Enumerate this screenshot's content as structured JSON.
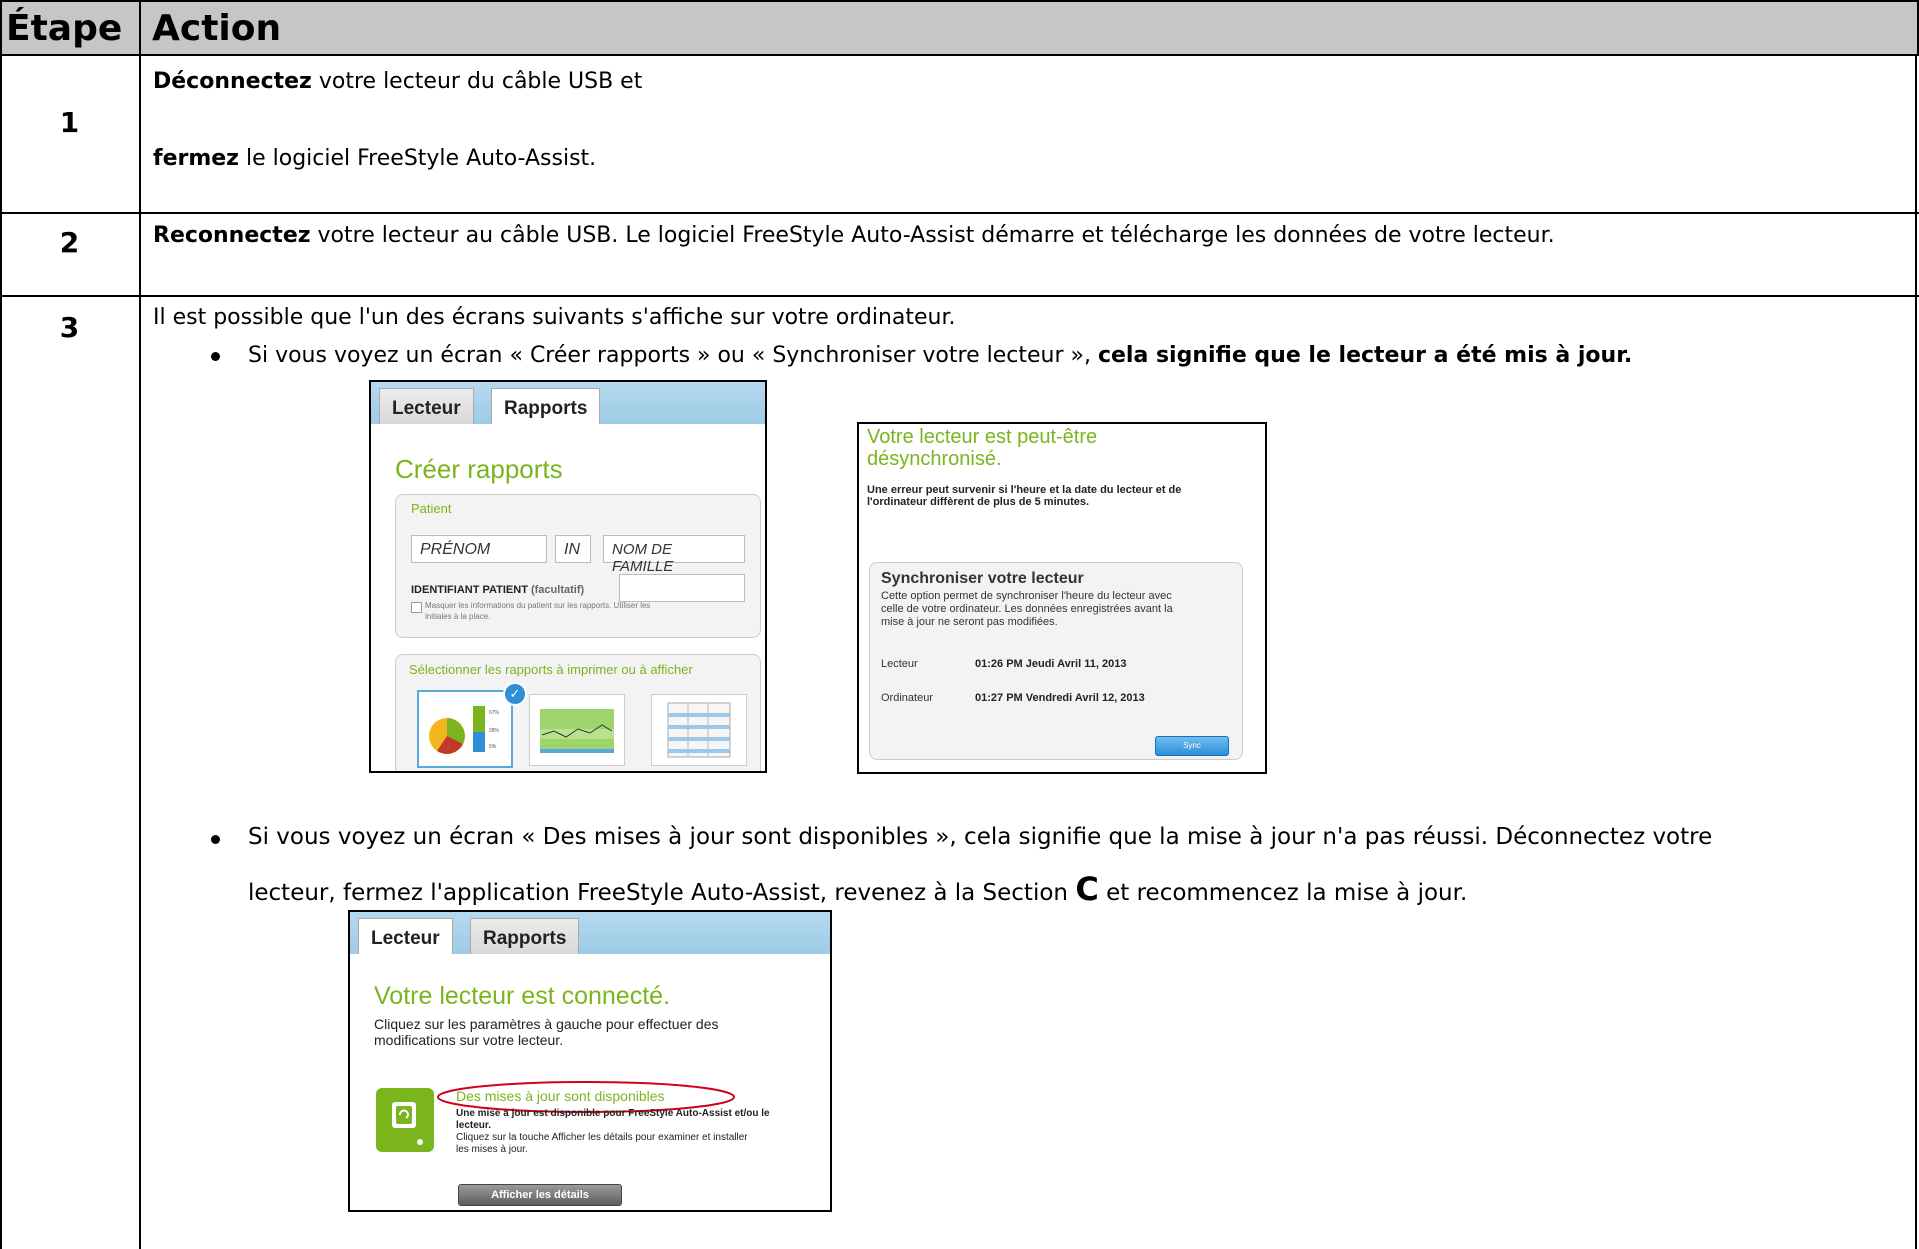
{
  "table": {
    "header": {
      "col1": "Étape",
      "col2": "Action"
    },
    "steps": [
      {
        "number": "1",
        "line1_bold": "Déconnectez",
        "line1_rest": " votre lecteur du câble USB et",
        "line2_bold": "fermez",
        "line2_rest": " le logiciel FreeStyle Auto-Assist."
      },
      {
        "number": "2",
        "line1_bold": "Reconnectez",
        "line1_rest": " votre lecteur au câble USB. Le logiciel FreeStyle Auto-Assist démarre et télécharge les données de votre lecteur."
      },
      {
        "number": "3",
        "intro": "Il est possible que l'un des écrans suivants s'affiche sur votre ordinateur.",
        "bullet1_plain": "Si vous voyez un écran « Créer rapports » ou « Synchroniser votre lecteur », ",
        "bullet1_bold": "cela signifie que le lecteur a été mis à jour.",
        "bullet2_line1": "Si vous voyez un écran « Des mises à jour sont disponibles », cela signifie que la mise à jour n'a pas réussi. Déconnectez votre",
        "bullet2_line2_a": "lecteur, fermez l'application FreeStyle Auto-Assist, revenez à la Section ",
        "bullet2_line2_c": "C",
        "bullet2_line2_b": " et recommencez la mise à jour."
      }
    ]
  },
  "shot_reports": {
    "tab_lecteur": "Lecteur",
    "tab_rapports": "Rapports",
    "title": "Créer rapports",
    "patient_label": "Patient",
    "first_name": "PRÉNOM",
    "initial": "IN",
    "last_name": "NOM DE FAMILLE",
    "patient_id_label": "IDENTIFIANT PATIENT",
    "optional": "(facultatif)",
    "mask_line1": "Masquer les informations du patient sur les rapports. Utiliser les",
    "mask_line2": "initiales à la place.",
    "select_reports": "Sélectionner les rapports à imprimer ou à afficher",
    "accent": "#7ab51d"
  },
  "shot_sync": {
    "title_line1": "Votre lecteur est peut-être",
    "title_line2": "désynchronisé.",
    "warn_line1": "Une erreur peut survenir si l'heure et la date du lecteur et de",
    "warn_line2": "l'ordinateur diffèrent de plus de 5 minutes.",
    "panel_title": "Synchroniser votre lecteur",
    "desc_line1": "Cette option permet de synchroniser l'heure du lecteur avec",
    "desc_line2": "celle de votre ordinateur. Les données enregistrées avant la",
    "desc_line3": "mise à jour ne seront pas modifiées.",
    "meter_label": "Lecteur",
    "meter_value": "01:26 PM Jeudi Avril 11, 2013",
    "computer_label": "Ordinateur",
    "computer_value": "01:27 PM Vendredi Avril 12, 2013",
    "sync_button": "Sync"
  },
  "shot_updates": {
    "tab_lecteur": "Lecteur",
    "tab_rapports": "Rapports",
    "title": "Votre lecteur est connecté.",
    "desc_line1": "Cliquez sur les paramètres à gauche pour effectuer des",
    "desc_line2": "modifications sur votre lecteur.",
    "updates_title": "Des mises à jour sont disponibles",
    "upd_line1": "Une mise à jour est disponible pour FreeStyle Auto-Assist et/ou le",
    "upd_line2": "lecteur.",
    "upd_line3": "Cliquez sur la touche Afficher les détails pour examiner et installer",
    "upd_line4": "les mises à jour.",
    "details_button": "Afficher les détails",
    "highlight_color": "#d0021b"
  }
}
